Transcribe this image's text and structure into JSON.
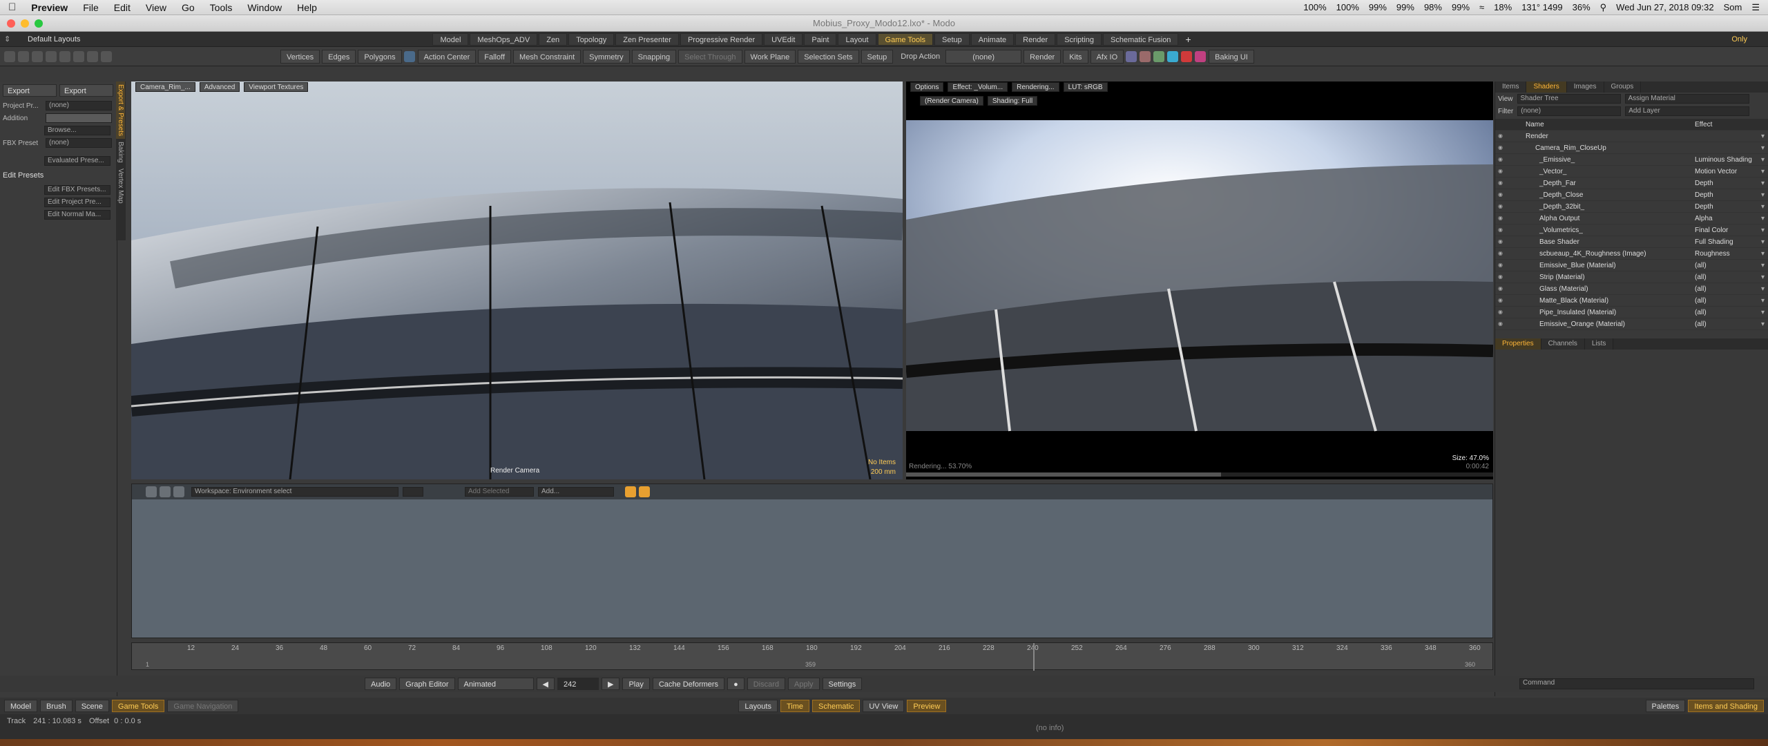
{
  "menubar": {
    "apple": "",
    "app": "Preview",
    "menus": [
      "File",
      "Edit",
      "View",
      "Go",
      "Tools",
      "Window",
      "Help"
    ],
    "status": [
      "100%",
      "100%",
      "99%",
      "99%",
      "98%",
      "99%",
      "18%",
      "131° 1499",
      "36%",
      "Wed Jun 27, 2018 09:32",
      "Som"
    ]
  },
  "window": {
    "title": "Mobius_Proxy_Modo12.lxo* - Modo"
  },
  "layout_bar": {
    "default_layouts": "Default Layouts",
    "tabs": [
      "Model",
      "MeshOps_ADV",
      "Zen",
      "Topology",
      "Zen Presenter",
      "Progressive Render",
      "UVEdit",
      "Paint",
      "Layout",
      "Game Tools",
      "Setup",
      "Animate",
      "Render",
      "Scripting",
      "Schematic Fusion"
    ],
    "active_tab": "Game Tools",
    "plus": "+",
    "only": "Only"
  },
  "toolbar": {
    "vertices": "Vertices",
    "edges": "Edges",
    "polygons": "Polygons",
    "action_center": "Action Center",
    "falloff": "Falloff",
    "mesh_constraint": "Mesh Constraint",
    "symmetry": "Symmetry",
    "snapping": "Snapping",
    "select_through": "Select Through",
    "work_plane": "Work Plane",
    "selection_sets": "Selection Sets",
    "setup": "Setup",
    "drop_action": "Drop Action",
    "drop_value": "(none)",
    "render": "Render",
    "kits": "Kits",
    "afx": "Afx IO",
    "baking": "Baking UI"
  },
  "left_panel": {
    "export1": "Export",
    "export2": "Export",
    "project_pr": "Project Pr...",
    "project_value": "(none)",
    "addition": "Addition",
    "browse": "Browse...",
    "fbx_preset": "FBX Preset",
    "fbx_value": "(none)",
    "evaluated": "Evaluated Prese...",
    "edit_presets": "Edit Presets",
    "edit_fbx": "Edit FBX Presets...",
    "edit_project": "Edit Project Pre...",
    "edit_normal": "Edit Normal Ma...",
    "vtabs": [
      "Export & Presets",
      "Baking",
      "Vertex Map"
    ]
  },
  "viewport1": {
    "tabs": [
      "Camera_Rim_...",
      "Advanced",
      "Viewport Textures"
    ],
    "camera_label": "Render Camera",
    "no_items": "No Items",
    "dist": "200 mm"
  },
  "viewport2": {
    "tabs": [
      "Options",
      "Effect: _Volum...",
      "Rendering...",
      "LUT: sRGB"
    ],
    "row2": [
      "(Render Camera)",
      "Shading: Full"
    ],
    "rendering": "Rendering... 53.70%",
    "size": "Size: 47.0%",
    "time": "0:00:42"
  },
  "shader_panel": {
    "tabs": [
      "Items",
      "Shaders",
      "Images",
      "Groups"
    ],
    "active_tab": "Shaders",
    "view_label": "View",
    "view_value": "Shader Tree",
    "assign_material": "Assign Material",
    "filter_label": "Filter",
    "filter_value": "(none)",
    "add_layer": "Add Layer",
    "col_name": "Name",
    "col_effect": "Effect",
    "rows": [
      {
        "name": "Render",
        "effect": ""
      },
      {
        "name": "Camera_Rim_CloseUp",
        "effect": ""
      },
      {
        "name": "_Emissive_",
        "effect": "Luminous Shading"
      },
      {
        "name": "_Vector_",
        "effect": "Motion Vector"
      },
      {
        "name": "_Depth_Far",
        "effect": "Depth"
      },
      {
        "name": "_Depth_Close",
        "effect": "Depth"
      },
      {
        "name": "_Depth_32bit_",
        "effect": "Depth"
      },
      {
        "name": "Alpha Output",
        "effect": "Alpha"
      },
      {
        "name": "_Volumetrics_",
        "effect": "Final Color"
      },
      {
        "name": "Base Shader",
        "effect": "Full Shading"
      },
      {
        "name": "scbueaup_4K_Roughness (Image)",
        "effect": "Roughness"
      },
      {
        "name": "Emissive_Blue (Material)",
        "effect": "(all)"
      },
      {
        "name": "Strip (Material)",
        "effect": "(all)"
      },
      {
        "name": "Glass (Material)",
        "effect": "(all)"
      },
      {
        "name": "Matte_Black (Material)",
        "effect": "(all)"
      },
      {
        "name": "Pipe_Insulated (Material)",
        "effect": "(all)"
      },
      {
        "name": "Emissive_Orange (Material)",
        "effect": "(all)"
      }
    ],
    "prop_tabs": [
      "Properties",
      "Channels",
      "Lists"
    ],
    "prop_active": "Properties"
  },
  "schematic": {
    "workspace": "Workspace: Environment select",
    "add_selected": "Add Selected",
    "add": "Add..."
  },
  "timeline": {
    "ticks": [
      "12",
      "24",
      "36",
      "48",
      "60",
      "72",
      "84",
      "96",
      "108",
      "120",
      "132",
      "144",
      "156",
      "168",
      "180",
      "192",
      "204",
      "216",
      "228",
      "240",
      "252",
      "264",
      "276",
      "288",
      "300",
      "312",
      "324",
      "336",
      "348",
      "360"
    ],
    "start": "1",
    "mid": "359",
    "end": "360"
  },
  "transport": {
    "audio": "Audio",
    "graph_editor": "Graph Editor",
    "animated": "Animated",
    "frame": "242",
    "play": "Play",
    "cache": "Cache Deformers",
    "discard": "Discard",
    "apply": "Apply",
    "settings": "Settings",
    "command": "Command"
  },
  "bottom": {
    "model": "Model",
    "brush": "Brush",
    "scene": "Scene",
    "game_tools": "Game Tools",
    "game_nav": "Game Navigation",
    "layouts": "Layouts",
    "time": "Time",
    "schematic": "Schematic",
    "uv_view": "UV View",
    "preview": "Preview",
    "palettes": "Palettes",
    "items_shading": "Items and Shading"
  },
  "statusbar": {
    "track": "Track",
    "track_val": "241 : 10.083 s",
    "offset": "Offset",
    "offset_val": "0 : 0.0 s",
    "info": "(no info)"
  }
}
